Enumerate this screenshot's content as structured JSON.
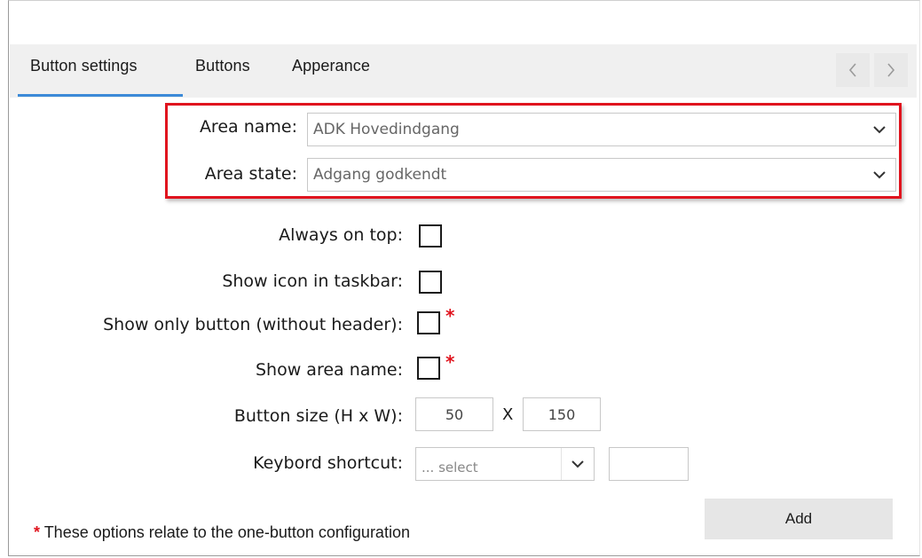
{
  "tabs": [
    {
      "label": "Button settings",
      "active": true
    },
    {
      "label": "Buttons",
      "active": false
    },
    {
      "label": "Apperance",
      "active": false
    }
  ],
  "nav": {
    "prev_icon": "chevron-left-icon",
    "next_icon": "chevron-right-icon"
  },
  "area": {
    "name_label": "Area name:",
    "name_value": "ADK Hovedindgang",
    "state_label": "Area state:",
    "state_value": "Adgang godkendt"
  },
  "options": {
    "always_on_top_label": "Always on top:",
    "always_on_top_checked": false,
    "show_icon_taskbar_label": "Show icon in taskbar:",
    "show_icon_taskbar_checked": false,
    "show_only_button_label": "Show only button (without header):",
    "show_only_button_checked": false,
    "show_area_name_label": "Show area name:",
    "show_area_name_checked": false,
    "required_marker": "*"
  },
  "button_size": {
    "label": "Button size (H x W):",
    "height": "50",
    "separator": "X",
    "width": "150"
  },
  "shortcut": {
    "label": "Keybord shortcut:",
    "select_value": "... select",
    "key_value": ""
  },
  "actions": {
    "add_label": "Add"
  },
  "footnote": {
    "marker": "*",
    "text": " These options relate to the one-button configuration"
  },
  "colors": {
    "accent": "#3c8ad8",
    "highlight": "#e0141e",
    "tab_bg": "#f0f0f0"
  }
}
